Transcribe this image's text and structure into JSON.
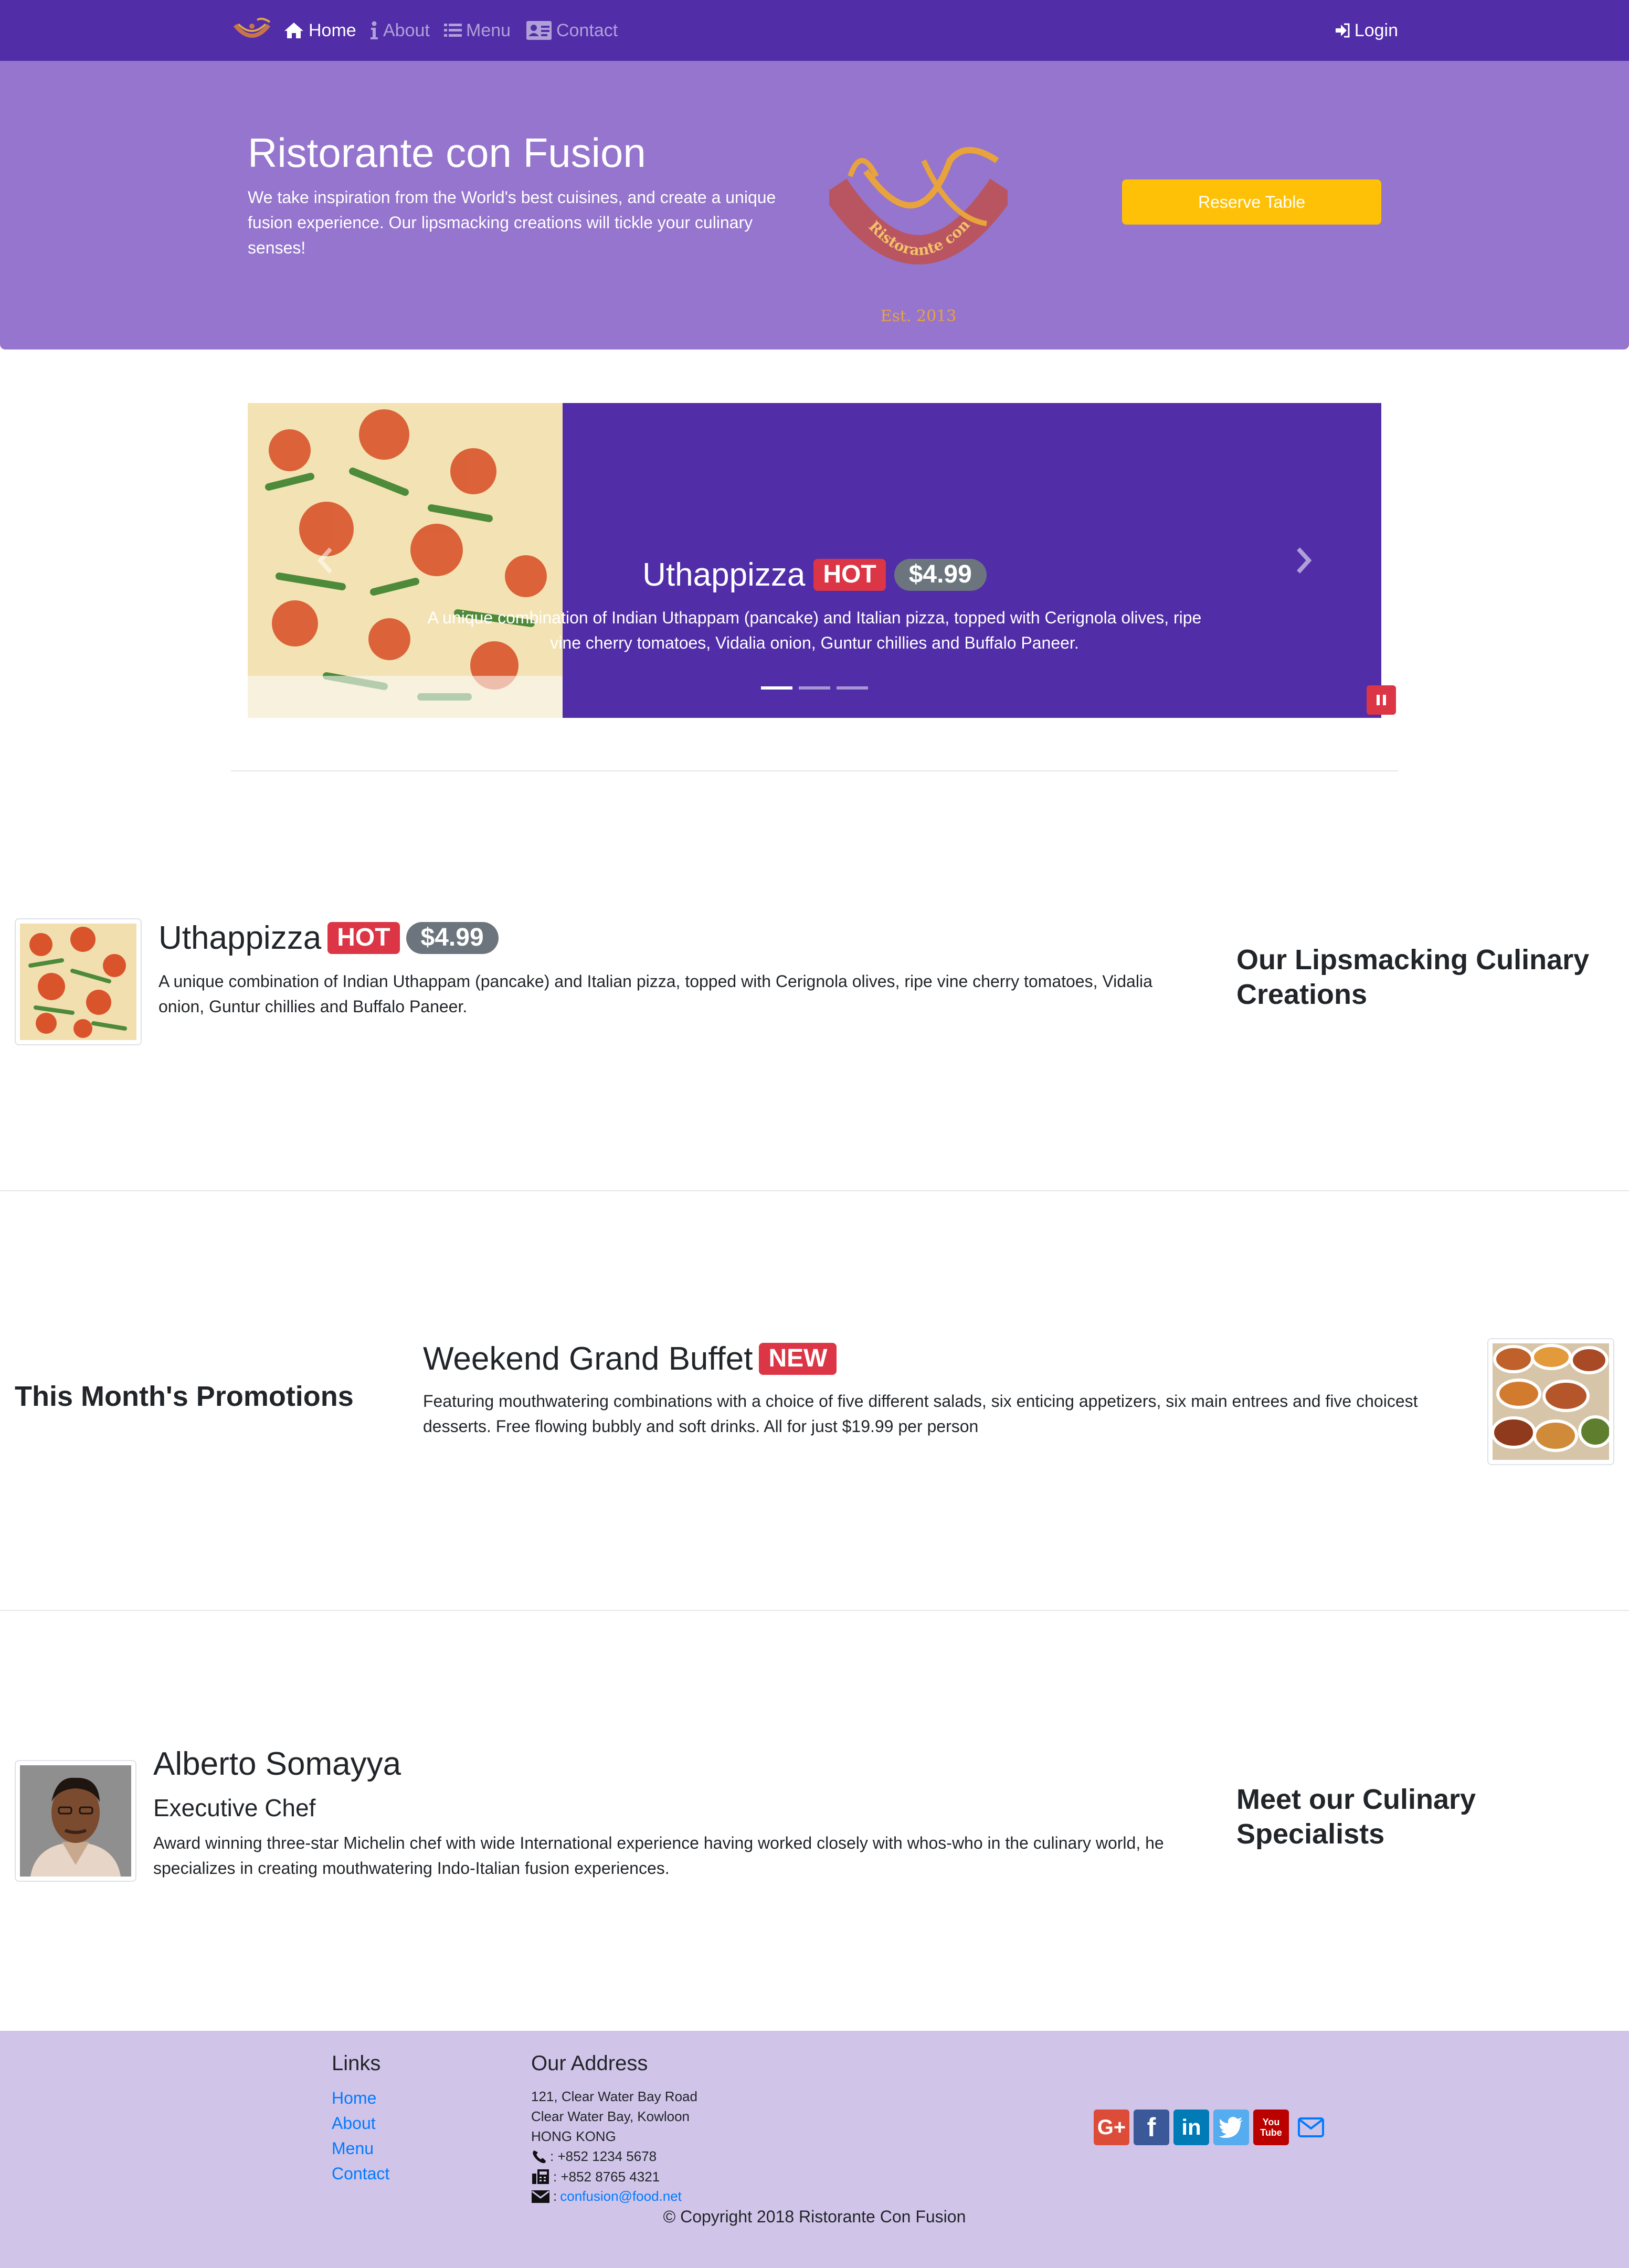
{
  "brand": {
    "primary": "#512da8",
    "jumbotron": "#9575cd",
    "footer": "#d1c4e9",
    "warning": "#ffc107",
    "danger": "#dc3545",
    "secondary": "#6c757d"
  },
  "navbar": {
    "items": [
      {
        "label": "Home",
        "icon": "home-icon",
        "active": true
      },
      {
        "label": "About",
        "icon": "info-icon"
      },
      {
        "label": "Menu",
        "icon": "list-icon"
      },
      {
        "label": "Contact",
        "icon": "address-card-icon"
      }
    ],
    "login_label": "Login"
  },
  "jumbotron": {
    "title": "Ristorante con Fusion",
    "text": "We take inspiration from the World's best cuisines, and create a unique fusion experience. Our lipsmacking creations will tickle your culinary senses!",
    "logo_text": "Ristorante con Fusion",
    "logo_est": "Est. 2013",
    "reserve_label": "Reserve Table"
  },
  "carousel": {
    "title": "Uthappizza",
    "badge": "HOT",
    "price": "$4.99",
    "text": "A unique combination of Indian Uthappam (pancake) and Italian pizza, topped with Cerignola olives, ripe vine cherry tomatoes, Vidalia onion, Guntur chillies and Buffalo Paneer.",
    "active_slide": 1,
    "slide_count": 3
  },
  "dish": {
    "title": "Uthappizza",
    "badge": "HOT",
    "price": "$4.99",
    "text": "A unique combination of Indian Uthappam (pancake) and Italian pizza, topped with Cerignola olives, ripe vine cherry tomatoes, Vidalia onion, Guntur chillies and Buffalo Paneer.",
    "heading": "Our Lipsmacking Culinary Creations"
  },
  "promotion": {
    "heading": "This Month's Promotions",
    "title": "Weekend Grand Buffet",
    "badge": "NEW",
    "text": "Featuring mouthwatering combinations with a choice of five different salads, six enticing appetizers, six main entrees and five choicest desserts. Free flowing bubbly and soft drinks. All for just $19.99 per person"
  },
  "leader": {
    "name": "Alberto Somayya",
    "role": "Executive Chef",
    "text": "Award winning three-star Michelin chef with wide International experience having worked closely with whos-who in the culinary world, he specializes in creating mouthwatering Indo-Italian fusion experiences.",
    "heading": "Meet our Culinary Specialists"
  },
  "footer": {
    "links_heading": "Links",
    "links": [
      "Home",
      "About",
      "Menu",
      "Contact"
    ],
    "address_heading": "Our Address",
    "address": [
      "121, Clear Water Bay Road",
      "Clear Water Bay, Kowloon",
      "HONG KONG"
    ],
    "phone": ": +852 1234 5678",
    "fax": ": +852 8765 4321",
    "email": "confusion@food.net",
    "email_prefix": ":",
    "social": [
      {
        "icon": "google-plus-icon",
        "label": "G+",
        "color": "#dd4b39"
      },
      {
        "icon": "facebook-icon",
        "label": "f",
        "color": "#3b5998"
      },
      {
        "icon": "linkedin-icon",
        "label": "in",
        "color": "#007bb6"
      },
      {
        "icon": "twitter-icon",
        "label": "",
        "color": "#55acee"
      },
      {
        "icon": "youtube-icon",
        "label": "You\nTube",
        "color": "#bb0000"
      },
      {
        "icon": "mail-icon",
        "label": "",
        "color": "#007bff"
      }
    ],
    "copyright": "© Copyright 2018 Ristorante Con Fusion"
  }
}
